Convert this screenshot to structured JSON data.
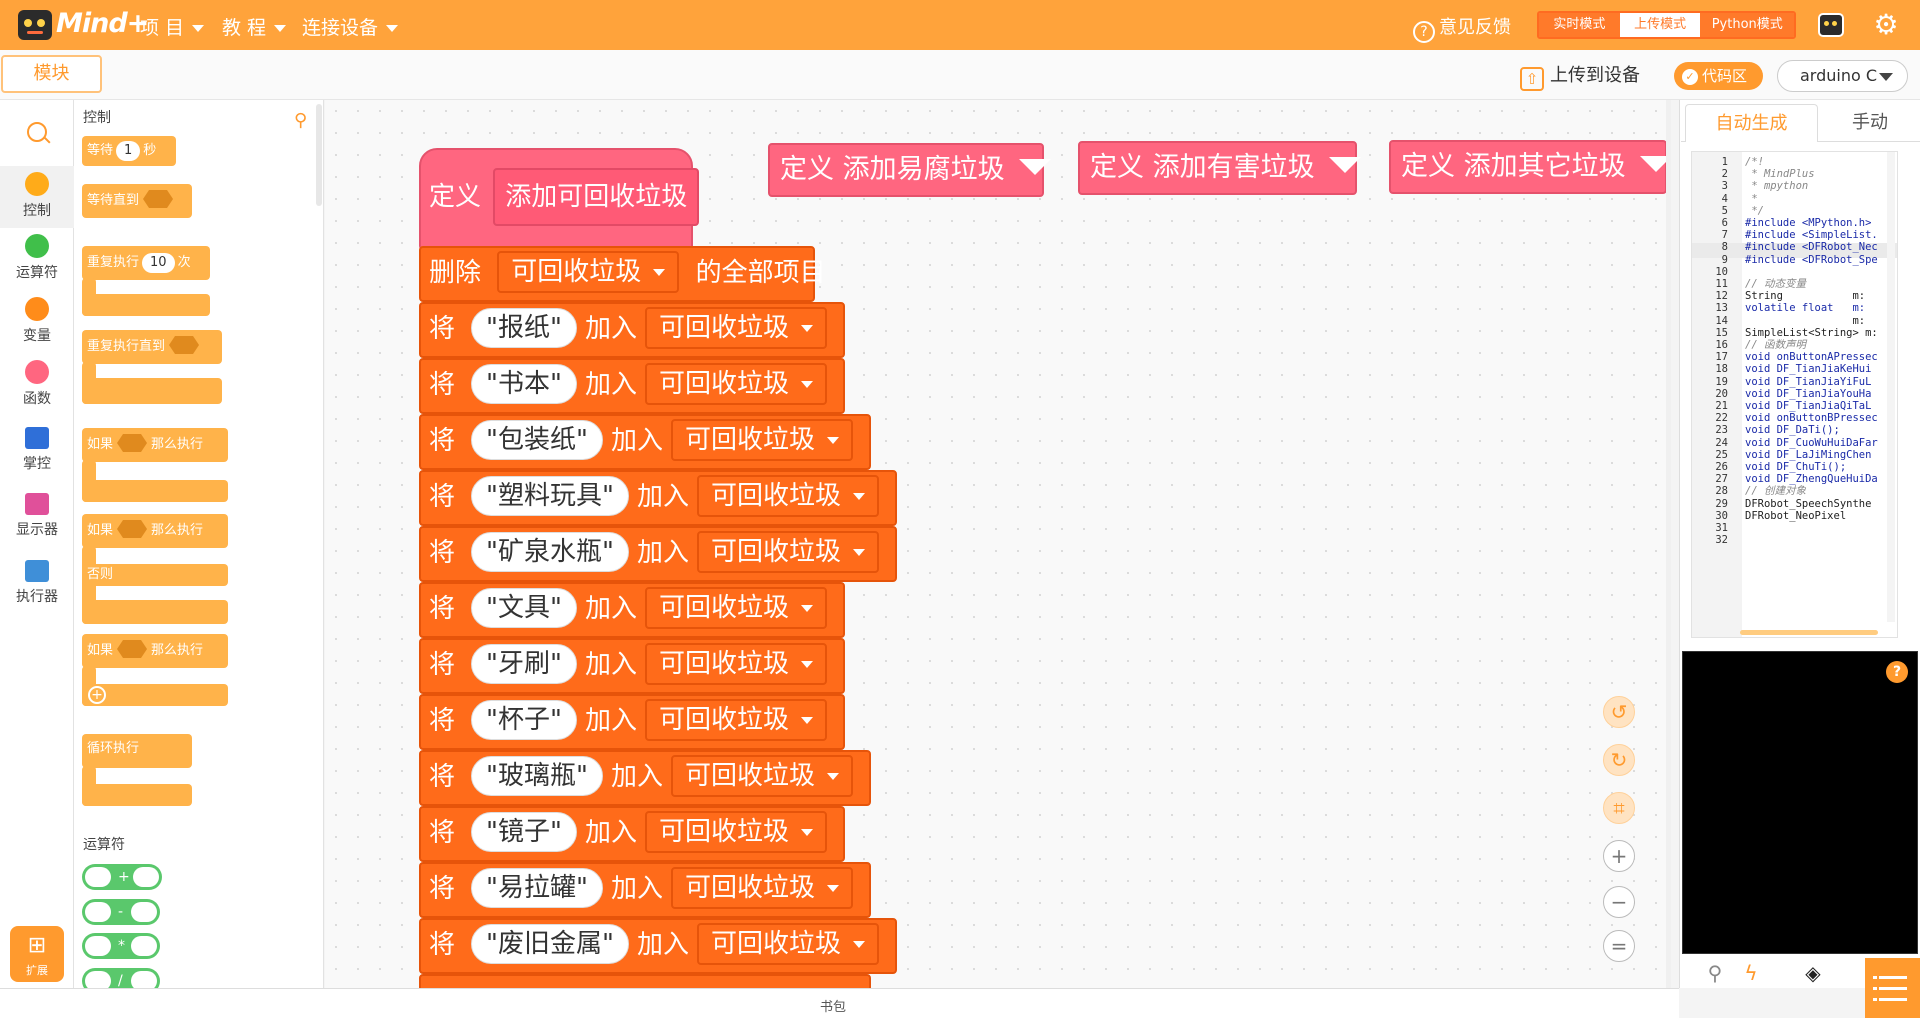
{
  "app": {
    "logo_text": "Mind+"
  },
  "top_menu": {
    "project": "项 目",
    "tutorial": "教 程",
    "connect": "连接设备"
  },
  "header": {
    "feedback": "意见反馈",
    "modes": {
      "realtime": "实时模式",
      "upload": "上传模式",
      "python": "Python模式"
    }
  },
  "toolbar": {
    "blocks_tab": "模块",
    "upload": "上传到设备",
    "code_area": "代码区",
    "board": "arduino C"
  },
  "categories": [
    {
      "label": "控制",
      "color": "#ffab19"
    },
    {
      "label": "运算符",
      "color": "#40bf4a"
    },
    {
      "label": "变量",
      "color": "#ff8c1a"
    },
    {
      "label": "函数",
      "color": "#ff6680"
    },
    {
      "label": "掌控",
      "color": "#2f6fd8"
    },
    {
      "label": "显示器",
      "color": "#e0509a"
    },
    {
      "label": "执行器",
      "color": "#3f8fd8"
    }
  ],
  "extension_label": "扩展",
  "flyout": {
    "section_control": "控制",
    "wait": "等待",
    "wait_value": "1",
    "wait_unit": "秒",
    "wait_until": "等待直到",
    "repeat": "重复执行",
    "repeat_value": "10",
    "repeat_unit": "次",
    "repeat_until": "重复执行直到",
    "if_then": "如果",
    "then": "那么执行",
    "else": "否则",
    "forever": "循环执行",
    "section_operators": "运算符",
    "ops": [
      "+",
      "-",
      "*",
      "/"
    ]
  },
  "workspace": {
    "define_label": "定义",
    "main_function": "添加可回收垃圾",
    "other_functions": [
      "添加易腐垃圾",
      "添加有害垃圾",
      "添加其它垃圾"
    ],
    "delete_stmt": {
      "prefix": "删除",
      "list": "可回收垃圾",
      "suffix": "的全部项目"
    },
    "add_prefix": "将",
    "add_mid": "加入",
    "target_list": "可回收垃圾",
    "items": [
      "报纸",
      "书本",
      "包装纸",
      "塑料玩具",
      "矿泉水瓶",
      "文具",
      "牙刷",
      "杯子",
      "玻璃瓶",
      "镜子",
      "易拉罐",
      "废旧金属"
    ]
  },
  "right_panel": {
    "tab_auto": "自动生成",
    "tab_manual": "手动",
    "code_lines": [
      "/*!",
      " * MindPlus",
      " * mpython",
      " *",
      " */",
      "#include <MPython.h>",
      "#include <SimpleList.",
      "#include <DFRobot_Nec",
      "#include <DFRobot_Spe",
      "",
      "// 动态变量",
      "String           m:",
      "volatile float   m:",
      "                 m:",
      "SimpleList<String> m:",
      "// 函数声明",
      "void onButtonAPressec",
      "void DF_TianJiaKeHui",
      "void DF_TianJiaYiFuL",
      "void DF_TianJiaYouHa",
      "void DF_TianJiaQiTaL",
      "void onButtonBPressec",
      "void DF_DaTi();",
      "void DF_CuoWuHuiDaFar",
      "void DF_LaJiMingChen",
      "void DF_ChuTi();",
      "void DF_ZhengQueHuiDa",
      "// 创建对象",
      "DFRobot_SpeechSynthe",
      "DFRobot_NeoPixel",
      "",
      ""
    ]
  },
  "bottom_bar": {
    "label": "书包"
  },
  "colors": {
    "accent": "#ffa33b",
    "function_block": "#ff6680",
    "list_block": "#ff6b1a"
  }
}
